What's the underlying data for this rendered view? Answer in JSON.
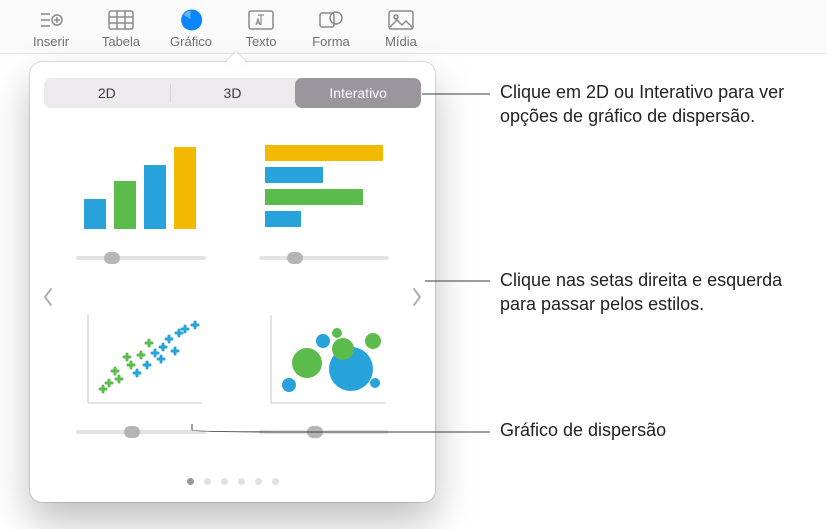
{
  "toolbar": {
    "items": [
      {
        "label": "Inserir"
      },
      {
        "label": "Tabela"
      },
      {
        "label": "Gráfico"
      },
      {
        "label": "Texto"
      },
      {
        "label": "Forma"
      },
      {
        "label": "Mídia"
      }
    ]
  },
  "popover": {
    "tabs": {
      "a": "2D",
      "b": "3D",
      "c": "Interativo"
    },
    "charts": [
      {
        "name": "interactive-column-chart"
      },
      {
        "name": "interactive-bar-chart"
      },
      {
        "name": "interactive-scatter-chart"
      },
      {
        "name": "interactive-bubble-chart"
      }
    ],
    "page_count": 6,
    "current_page": 1
  },
  "callouts": {
    "c1": "Clique em 2D ou Interativo para ver opções de gráfico de dispersão.",
    "c2": "Clique nas setas direita e esquerda para passar pelos estilos.",
    "c3": "Gráfico de dispersão"
  },
  "colors": {
    "blue": "#27A2DA",
    "green": "#5BBB4B",
    "yellow": "#F3B900"
  }
}
